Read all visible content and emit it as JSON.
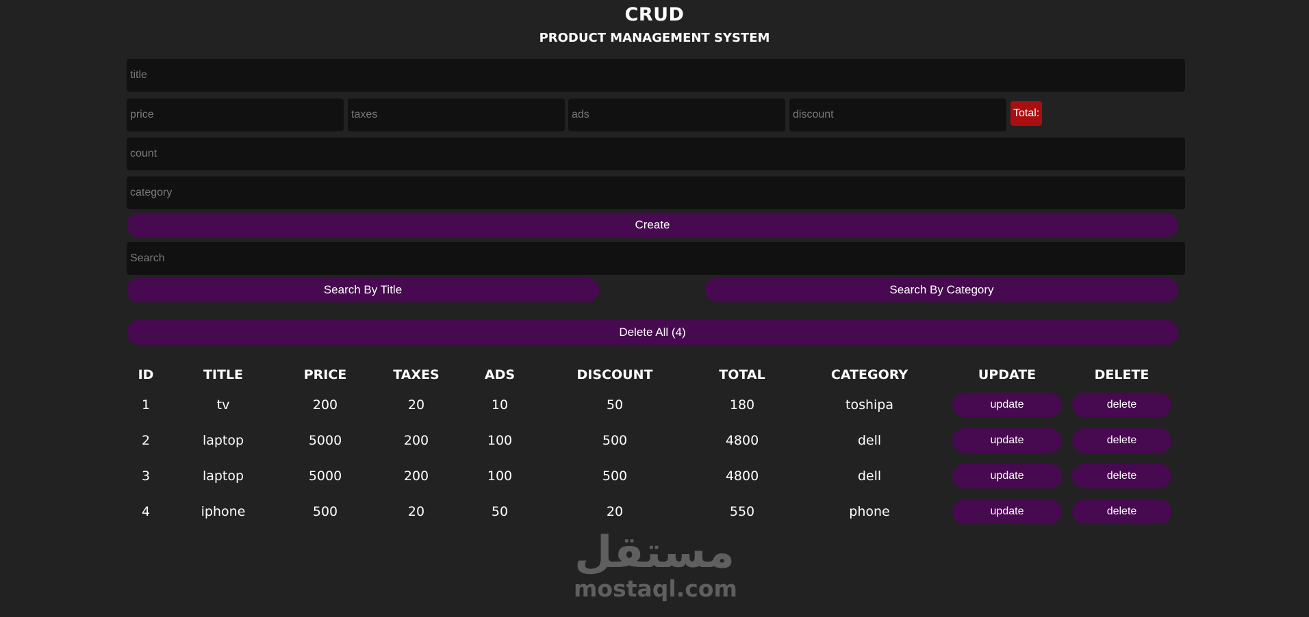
{
  "header": {
    "title": "CRUD",
    "subtitle": "PRODUCT MANAGEMENT SYSTEM"
  },
  "form": {
    "title_placeholder": "title",
    "price_placeholder": "price",
    "taxes_placeholder": "taxes",
    "ads_placeholder": "ads",
    "discount_placeholder": "discount",
    "total_label": "Total:",
    "count_placeholder": "count",
    "category_placeholder": "category",
    "create_label": "Create"
  },
  "search": {
    "placeholder": "Search",
    "by_title_label": "Search By Title",
    "by_category_label": "Search By Category"
  },
  "delete_all_label": "Delete All (4)",
  "table": {
    "headers": [
      "ID",
      "TITLE",
      "PRICE",
      "TAXES",
      "ADS",
      "DISCOUNT",
      "TOTAL",
      "CATEGORY",
      "UPDATE",
      "DELETE"
    ],
    "rows": [
      {
        "id": "1",
        "title": "tv",
        "price": "200",
        "taxes": "20",
        "ads": "10",
        "discount": "50",
        "total": "180",
        "category": "toshipa",
        "update": "update",
        "delete": "delete"
      },
      {
        "id": "2",
        "title": "laptop",
        "price": "5000",
        "taxes": "200",
        "ads": "100",
        "discount": "500",
        "total": "4800",
        "category": "dell",
        "update": "update",
        "delete": "delete"
      },
      {
        "id": "3",
        "title": "laptop",
        "price": "5000",
        "taxes": "200",
        "ads": "100",
        "discount": "500",
        "total": "4800",
        "category": "dell",
        "update": "update",
        "delete": "delete"
      },
      {
        "id": "4",
        "title": "iphone",
        "price": "500",
        "taxes": "20",
        "ads": "50",
        "discount": "20",
        "total": "550",
        "category": "phone",
        "update": "update",
        "delete": "delete"
      }
    ]
  },
  "watermark": {
    "arabic": "مستقل",
    "latin": "mostaql.com"
  },
  "colors": {
    "background": "#222222",
    "input_bg": "#111111",
    "button_purple": "#470950",
    "total_red": "#aa0f0f"
  }
}
